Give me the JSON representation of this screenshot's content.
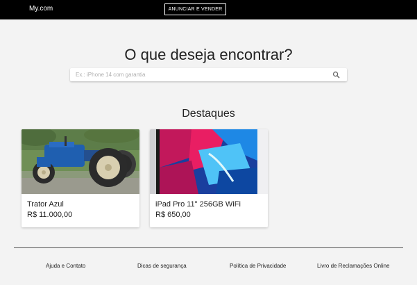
{
  "header": {
    "brand": "My.com",
    "sell_button": "ANUNCIAR E VENDER"
  },
  "hero": {
    "title": "O que deseja encontrar?",
    "search_placeholder": "Ex.: iPhone 14 com garantia",
    "search_value": ""
  },
  "featured": {
    "title": "Destaques",
    "items": [
      {
        "name": "Trator Azul",
        "price": "R$ 11.000,00",
        "image": "blue-tractor-photo"
      },
      {
        "name": "iPad Pro 11\" 256GB WiFi",
        "price": "R$ 650,00",
        "image": "ipad-pro-photo"
      }
    ]
  },
  "footer": {
    "links": [
      "Ajuda e Contato",
      "Dicas de segurança",
      "Política de Privacidade",
      "Livro de Reclamações Online"
    ]
  }
}
